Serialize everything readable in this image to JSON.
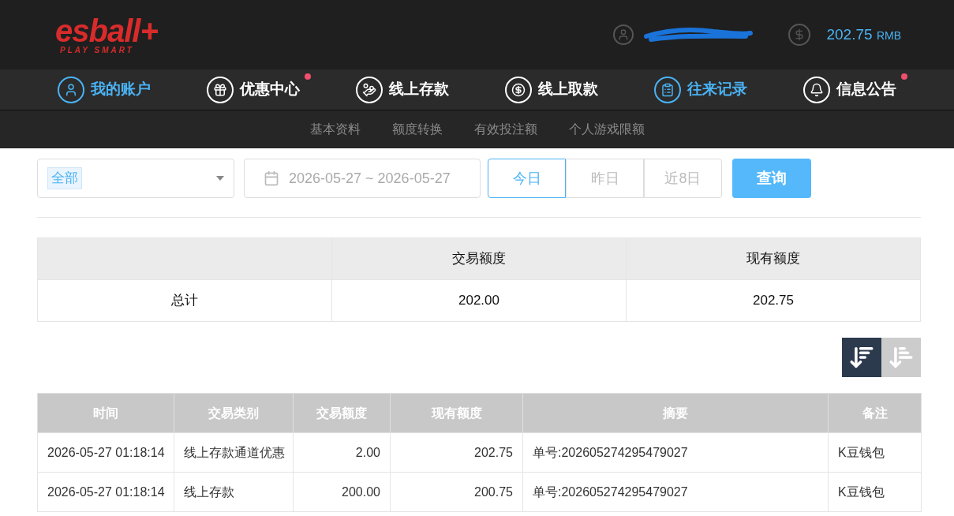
{
  "header": {
    "logo": {
      "name": "esball+",
      "tagline": "PLAY SMART"
    },
    "balance": {
      "amount": "202.75",
      "currency": "RMB"
    }
  },
  "nav": [
    {
      "label": "我的账户",
      "kind": "user",
      "selected": true,
      "badge": false
    },
    {
      "label": "优惠中心",
      "kind": "gift",
      "selected": false,
      "badge": true
    },
    {
      "label": "线上存款",
      "kind": "deposit",
      "selected": false,
      "badge": false
    },
    {
      "label": "线上取款",
      "kind": "withdraw",
      "selected": false,
      "badge": false
    },
    {
      "label": "往来记录",
      "kind": "records",
      "selected": true,
      "badge": false
    },
    {
      "label": "信息公告",
      "kind": "bell",
      "selected": false,
      "badge": true
    }
  ],
  "subnav": [
    "基本资料",
    "额度转换",
    "有效投注额",
    "个人游戏限额"
  ],
  "filter": {
    "type_tag": "全部",
    "date_range": "2026-05-27 ~ 2026-05-27",
    "ranges": [
      {
        "label": "今日",
        "selected": true
      },
      {
        "label": "昨日",
        "selected": false
      },
      {
        "label": "近8日",
        "selected": false
      }
    ],
    "search_button": "查询"
  },
  "summary": {
    "columns": [
      "交易额度",
      "现有额度"
    ],
    "row": {
      "label": "总计",
      "values": [
        "202.00",
        "202.75"
      ]
    }
  },
  "sort_buttons": [
    {
      "kind": "desc",
      "selected": true
    },
    {
      "kind": "asc",
      "selected": false
    }
  ],
  "table": {
    "columns": [
      "时间",
      "交易类别",
      "交易额度",
      "现有额度",
      "摘要",
      "备注"
    ],
    "rows": [
      [
        "2026-05-27 01:18:14",
        "线上存款通道优惠",
        "2.00",
        "202.75",
        "单号:202605274295479027",
        "K豆钱包"
      ],
      [
        "2026-05-27 01:18:14",
        "线上存款",
        "200.00",
        "200.75",
        "单号:202605274295479027",
        "K豆钱包"
      ]
    ]
  }
}
